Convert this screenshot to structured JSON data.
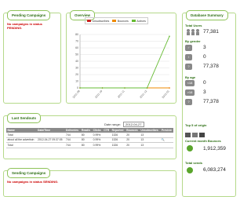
{
  "pending": {
    "tab": "Pending Campaigns",
    "error_line1": "No campaigns in status",
    "error_line2": "PENDING."
  },
  "overview": {
    "tab": "Overview",
    "legend": [
      {
        "label": "Unsubscribes",
        "color": "#cc2222"
      },
      {
        "label": "Bounces",
        "color": "#ee8a00"
      },
      {
        "label": "Actives",
        "color": "#66bb33"
      }
    ]
  },
  "chart_data": {
    "type": "line",
    "categories": [
      "2011-09",
      "2011-10",
      "2011-11",
      "2011-12",
      "2012-01"
    ],
    "ylim": [
      0,
      80000
    ],
    "yticks": [
      0,
      10,
      20,
      30,
      40,
      50,
      60,
      70,
      80
    ],
    "series": [
      {
        "name": "Unsubscribes",
        "values": [
          0,
          0,
          0,
          0,
          0
        ]
      },
      {
        "name": "Bounces",
        "values": [
          0,
          0,
          0,
          0,
          0
        ]
      },
      {
        "name": "Actives",
        "values": [
          0,
          0,
          0,
          0,
          77381
        ]
      }
    ],
    "grid": true
  },
  "summary": {
    "tab": "Database Summary",
    "total_users_label": "Total Users",
    "total_users_value": "77,381",
    "by_gender_label": "By gender",
    "gender": [
      {
        "icon": "male-icon",
        "value": "3"
      },
      {
        "icon": "female-icon",
        "value": "0"
      },
      {
        "icon": "unknown-icon",
        "value": "77,378"
      }
    ],
    "by_age_label": "By age",
    "age": [
      {
        "icon": "age-under-icon",
        "text": "<18",
        "value": "0"
      },
      {
        "icon": "age-over-icon",
        "text": ">18",
        "value": "3"
      },
      {
        "icon": "age-unknown-icon",
        "text": "?",
        "value": "77,378"
      }
    ],
    "top5_label": "Top 5 of origin",
    "current_month_label": "Current month Bounces",
    "current_month_value": "1,912,359",
    "total_sends_label": "Total sends",
    "total_sends_value": "6,083,274"
  },
  "last_sends": {
    "tab": "Last Sendouts",
    "date_range_label": "Date range:",
    "date_range_value": "2012-04-27",
    "columns": [
      "Name",
      "Date/Time",
      "Deliveries",
      "Read/s",
      "Clicks",
      "CTR",
      "Reported",
      "Bounces",
      "Unsubscribes",
      "Preview"
    ],
    "rows": [
      [
        "Total",
        "",
        "744",
        "80",
        "0.99%",
        "",
        "1326",
        "20",
        "13",
        ""
      ],
      [
        "about all the advertisin",
        "2012-04-27 09:37:05",
        "744",
        "80",
        "0.99%",
        "",
        "1326",
        "20",
        "13",
        "🔍"
      ],
      [
        "Total",
        "",
        "744",
        "80",
        "0.99%",
        "",
        "1326",
        "20",
        "13",
        ""
      ]
    ]
  },
  "sending": {
    "tab": "Sending Campaigns",
    "error": "No campaigns in status SENDING."
  }
}
